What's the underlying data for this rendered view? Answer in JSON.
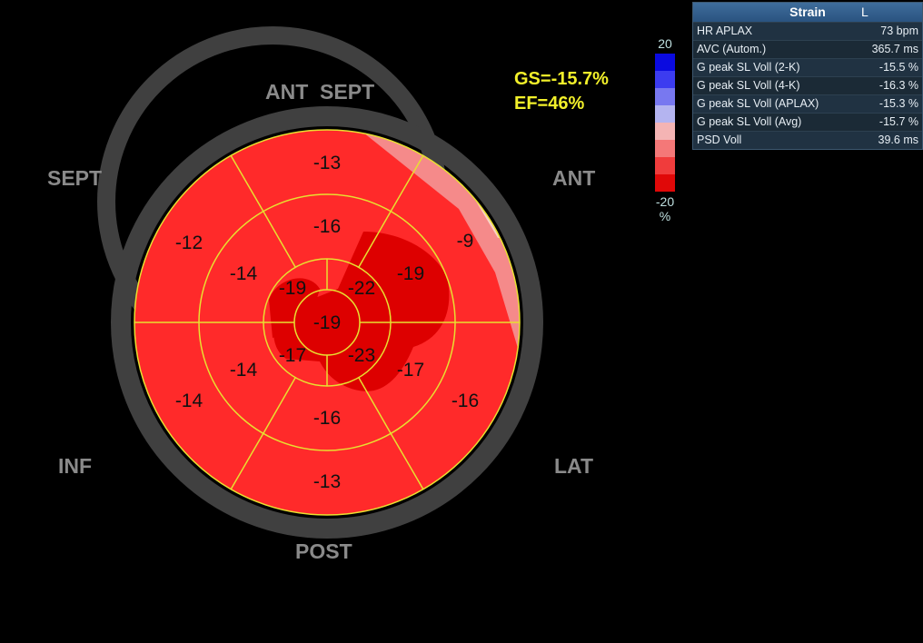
{
  "views": {
    "ant_sept": "ANT  SEPT",
    "sept": "SEPT",
    "ant": "ANT",
    "inf": "INF",
    "lat": "LAT",
    "post": "POST"
  },
  "summary": {
    "gs": "GS=-15.7%",
    "ef": "EF=46%"
  },
  "segments": {
    "basal": [
      "-13",
      "-9",
      "-16",
      "-13",
      "-14",
      "-12"
    ],
    "mid": [
      "-16",
      "-19",
      "-17",
      "-16",
      "-14",
      "-14"
    ],
    "apical": [
      "-22",
      "-23",
      "-17",
      "-19"
    ],
    "apex": "-19"
  },
  "scale": {
    "max": "20",
    "min": "-20",
    "unit": "%",
    "colors": [
      "#0a0ae0",
      "#3c3cf0",
      "#7878f0",
      "#b4b4f0",
      "#f4b4b4",
      "#f47878",
      "#f03c3c",
      "#e00808"
    ]
  },
  "colors": {
    "segment": "#ff2a2a",
    "hot": "#dd0000",
    "pale": "#f58a8a",
    "ring": "#404040",
    "grid": "#e8e030"
  },
  "panel": {
    "title": "Strain",
    "title_mark": "L",
    "rows": [
      {
        "label": "HR APLAX",
        "value": "73 bpm"
      },
      {
        "label": "AVC (Autom.)",
        "value": "365.7 ms"
      },
      {
        "label": "G peak SL Voll (2-K)",
        "value": "-15.5 %"
      },
      {
        "label": "G peak SL Voll (4-K)",
        "value": "-16.3 %"
      },
      {
        "label": "G peak SL Voll (APLAX)",
        "value": "-15.3 %"
      },
      {
        "label": "G peak SL Voll (Avg)",
        "value": "-15.7 %"
      },
      {
        "label": "PSD Voll",
        "value": "39.6 ms"
      }
    ]
  }
}
